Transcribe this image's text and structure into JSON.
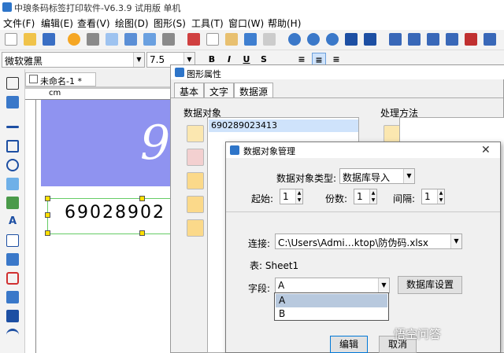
{
  "app": {
    "title": "中琅条码标签打印软件-V6.3.9 试用版 单机"
  },
  "menu": [
    "文件(F)",
    "编辑(E)",
    "查看(V)",
    "绘图(D)",
    "图形(S)",
    "工具(T)",
    "窗口(W)",
    "帮助(H)"
  ],
  "font": {
    "family": "微软雅黑",
    "size": "7.5"
  },
  "document": {
    "tab": "未命名-1 *",
    "ruler_unit": "cm",
    "barcode_value": "69028902",
    "big_digit": "9"
  },
  "props": {
    "title": "图形属性",
    "tabs": [
      "基本",
      "文字",
      "数据源"
    ],
    "data_objects_label": "数据对象",
    "process_label": "处理方法",
    "data_item": "690289023413"
  },
  "dialog": {
    "title": "数据对象管理",
    "type_label": "数据对象类型:",
    "type_value": "数据库导入",
    "start_label": "起始:",
    "start_value": "1",
    "copies_label": "份数:",
    "copies_value": "1",
    "interval_label": "间隔:",
    "interval_value": "1",
    "connect_label": "连接:",
    "connect_value": "C:\\Users\\Admi…ktop\\防伪码.xlsx",
    "table_text": "表: Sheet1",
    "field_label": "字段:",
    "field_value": "A",
    "field_options": [
      "A",
      "B"
    ],
    "db_settings_button": "数据库设置",
    "edit_button": "编辑",
    "cancel_button": "取消"
  },
  "watermark": "悟空问答"
}
